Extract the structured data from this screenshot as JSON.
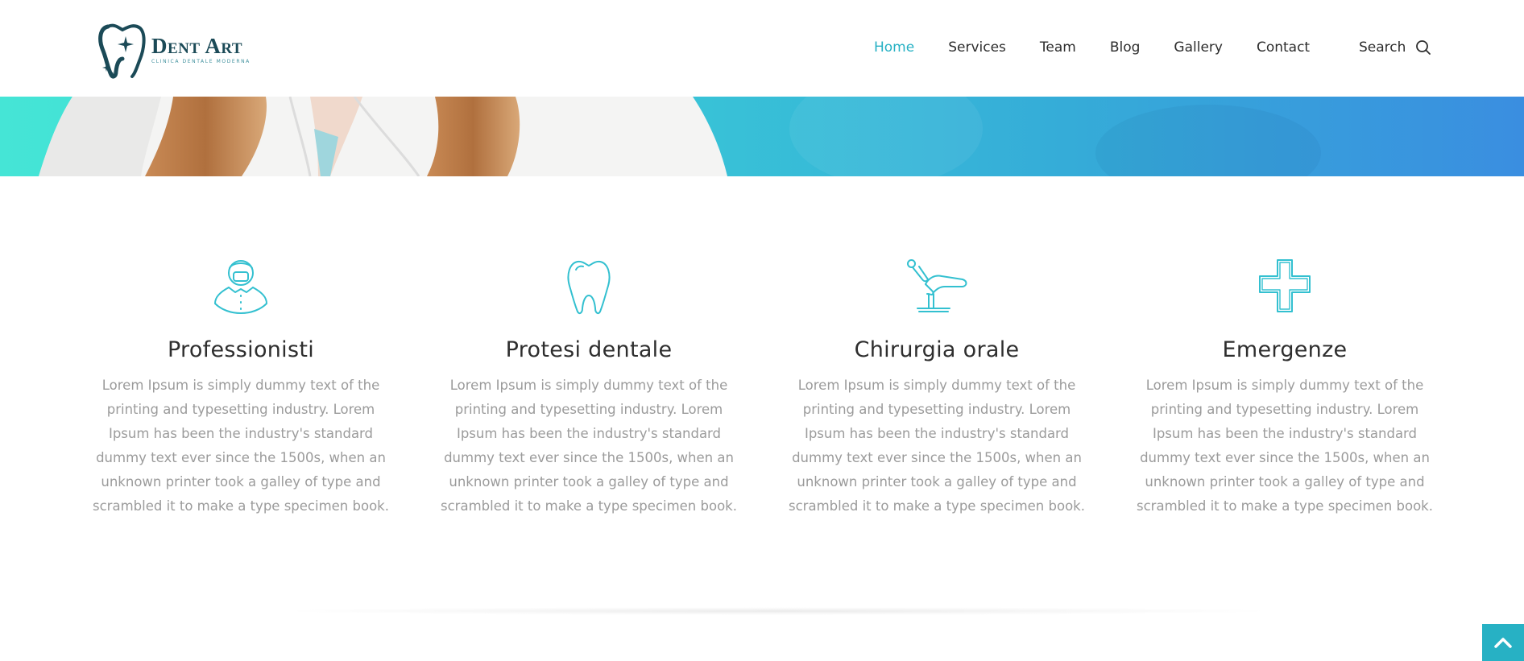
{
  "brand": {
    "name": "Dent Art",
    "tagline": "Clinica dentale moderna",
    "accent_color": "#27b1c4",
    "brand_color": "#1b4a57"
  },
  "nav": {
    "items": [
      {
        "label": "Home",
        "active": true
      },
      {
        "label": "Services",
        "active": false
      },
      {
        "label": "Team",
        "active": false
      },
      {
        "label": "Blog",
        "active": false
      },
      {
        "label": "Gallery",
        "active": false
      },
      {
        "label": "Contact",
        "active": false
      }
    ],
    "search_label": "Search",
    "search_icon": "search-icon"
  },
  "services": [
    {
      "icon": "dentist-icon",
      "title": "Professionisti",
      "text": "Lorem Ipsum is simply dummy text of the printing and typesetting industry. Lorem Ipsum has been the industry's standard dummy text ever since the 1500s, when an unknown printer took a galley of type and scrambled it to make a type specimen book."
    },
    {
      "icon": "tooth-icon",
      "title": "Protesi dentale",
      "text": "Lorem Ipsum is simply dummy text of the printing and typesetting industry. Lorem Ipsum has been the industry's standard dummy text ever since the 1500s, when an unknown printer took a galley of type and scrambled it to make a type specimen book."
    },
    {
      "icon": "dental-chair-icon",
      "title": "Chirurgia orale",
      "text": "Lorem Ipsum is simply dummy text of the printing and typesetting industry. Lorem Ipsum has been the industry's standard dummy text ever since the 1500s, when an unknown printer took a galley of type and scrambled it to make a type specimen book."
    },
    {
      "icon": "medical-cross-icon",
      "title": "Emergenze",
      "text": "Lorem Ipsum is simply dummy text of the printing and typesetting industry. Lorem Ipsum has been the industry's standard dummy text ever since the 1500s, when an unknown printer took a galley of type and scrambled it to make a type specimen book."
    }
  ],
  "scroll_to_top": {
    "icon": "chevron-up-icon"
  }
}
